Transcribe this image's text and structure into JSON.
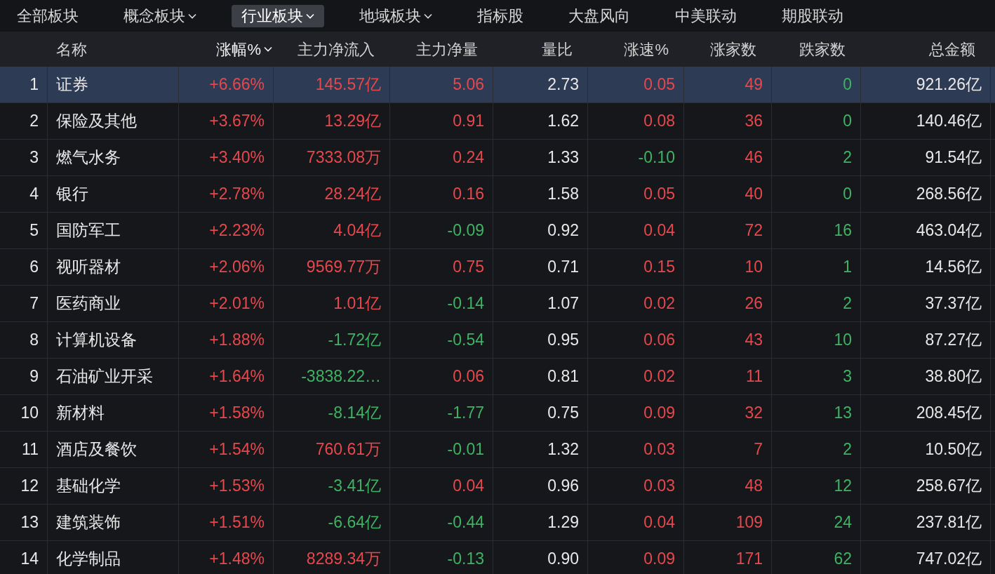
{
  "tabs": [
    {
      "label": "全部板块",
      "selected": false,
      "dropdown": false
    },
    {
      "label": "概念板块",
      "selected": false,
      "dropdown": true
    },
    {
      "label": "行业板块",
      "selected": true,
      "dropdown": true
    },
    {
      "label": "地域板块",
      "selected": false,
      "dropdown": true
    },
    {
      "label": "指标股",
      "selected": false,
      "dropdown": false
    },
    {
      "label": "大盘风向",
      "selected": false,
      "dropdown": false
    },
    {
      "label": "中美联动",
      "selected": false,
      "dropdown": false
    },
    {
      "label": "期股联动",
      "selected": false,
      "dropdown": false
    }
  ],
  "table": {
    "columns": [
      {
        "sorted": false
      },
      {
        "label": "名称",
        "sorted": false
      },
      {
        "label": "涨幅%",
        "sorted": true
      },
      {
        "label": "主力净流入",
        "sorted": false
      },
      {
        "label": "主力净量",
        "sorted": false
      },
      {
        "label": "量比",
        "sorted": false
      },
      {
        "label": "涨速%",
        "sorted": false
      },
      {
        "label": "涨家数",
        "sorted": false
      },
      {
        "label": "跌家数",
        "sorted": false
      },
      {
        "label": "总金额",
        "sorted": false
      }
    ],
    "rows": [
      {
        "selected": true,
        "cells": [
          {
            "text": "1",
            "color": "#e8e8e8"
          },
          {
            "text": "证券",
            "color": "#e8e8e8"
          },
          {
            "text": "+6.66%",
            "color": "#e5484d"
          },
          {
            "text": "145.57亿",
            "color": "#e5484d"
          },
          {
            "text": "5.06",
            "color": "#e5484d"
          },
          {
            "text": "2.73",
            "color": "#e8e8e8"
          },
          {
            "text": "0.05",
            "color": "#e5484d"
          },
          {
            "text": "49",
            "color": "#e5484d"
          },
          {
            "text": "0",
            "color": "#3fb264"
          },
          {
            "text": "921.26亿",
            "color": "#e8e8e8"
          }
        ]
      },
      {
        "selected": false,
        "cells": [
          {
            "text": "2",
            "color": "#e8e8e8"
          },
          {
            "text": "保险及其他",
            "color": "#e8e8e8"
          },
          {
            "text": "+3.67%",
            "color": "#e5484d"
          },
          {
            "text": "13.29亿",
            "color": "#e5484d"
          },
          {
            "text": "0.91",
            "color": "#e5484d"
          },
          {
            "text": "1.62",
            "color": "#e8e8e8"
          },
          {
            "text": "0.08",
            "color": "#e5484d"
          },
          {
            "text": "36",
            "color": "#e5484d"
          },
          {
            "text": "0",
            "color": "#3fb264"
          },
          {
            "text": "140.46亿",
            "color": "#e8e8e8"
          }
        ]
      },
      {
        "selected": false,
        "cells": [
          {
            "text": "3",
            "color": "#e8e8e8"
          },
          {
            "text": "燃气水务",
            "color": "#e8e8e8"
          },
          {
            "text": "+3.40%",
            "color": "#e5484d"
          },
          {
            "text": "7333.08万",
            "color": "#e5484d"
          },
          {
            "text": "0.24",
            "color": "#e5484d"
          },
          {
            "text": "1.33",
            "color": "#e8e8e8"
          },
          {
            "text": "-0.10",
            "color": "#3fb264"
          },
          {
            "text": "46",
            "color": "#e5484d"
          },
          {
            "text": "2",
            "color": "#3fb264"
          },
          {
            "text": "91.54亿",
            "color": "#e8e8e8"
          }
        ]
      },
      {
        "selected": false,
        "cells": [
          {
            "text": "4",
            "color": "#e8e8e8"
          },
          {
            "text": "银行",
            "color": "#e8e8e8"
          },
          {
            "text": "+2.78%",
            "color": "#e5484d"
          },
          {
            "text": "28.24亿",
            "color": "#e5484d"
          },
          {
            "text": "0.16",
            "color": "#e5484d"
          },
          {
            "text": "1.58",
            "color": "#e8e8e8"
          },
          {
            "text": "0.05",
            "color": "#e5484d"
          },
          {
            "text": "40",
            "color": "#e5484d"
          },
          {
            "text": "0",
            "color": "#3fb264"
          },
          {
            "text": "268.56亿",
            "color": "#e8e8e8"
          }
        ]
      },
      {
        "selected": false,
        "cells": [
          {
            "text": "5",
            "color": "#e8e8e8"
          },
          {
            "text": "国防军工",
            "color": "#e8e8e8"
          },
          {
            "text": "+2.23%",
            "color": "#e5484d"
          },
          {
            "text": "4.04亿",
            "color": "#e5484d"
          },
          {
            "text": "-0.09",
            "color": "#3fb264"
          },
          {
            "text": "0.92",
            "color": "#e8e8e8"
          },
          {
            "text": "0.04",
            "color": "#e5484d"
          },
          {
            "text": "72",
            "color": "#e5484d"
          },
          {
            "text": "16",
            "color": "#3fb264"
          },
          {
            "text": "463.04亿",
            "color": "#e8e8e8"
          }
        ]
      },
      {
        "selected": false,
        "cells": [
          {
            "text": "6",
            "color": "#e8e8e8"
          },
          {
            "text": "视听器材",
            "color": "#e8e8e8"
          },
          {
            "text": "+2.06%",
            "color": "#e5484d"
          },
          {
            "text": "9569.77万",
            "color": "#e5484d"
          },
          {
            "text": "0.75",
            "color": "#e5484d"
          },
          {
            "text": "0.71",
            "color": "#e8e8e8"
          },
          {
            "text": "0.15",
            "color": "#e5484d"
          },
          {
            "text": "10",
            "color": "#e5484d"
          },
          {
            "text": "1",
            "color": "#3fb264"
          },
          {
            "text": "14.56亿",
            "color": "#e8e8e8"
          }
        ]
      },
      {
        "selected": false,
        "cells": [
          {
            "text": "7",
            "color": "#e8e8e8"
          },
          {
            "text": "医药商业",
            "color": "#e8e8e8"
          },
          {
            "text": "+2.01%",
            "color": "#e5484d"
          },
          {
            "text": "1.01亿",
            "color": "#e5484d"
          },
          {
            "text": "-0.14",
            "color": "#3fb264"
          },
          {
            "text": "1.07",
            "color": "#e8e8e8"
          },
          {
            "text": "0.02",
            "color": "#e5484d"
          },
          {
            "text": "26",
            "color": "#e5484d"
          },
          {
            "text": "2",
            "color": "#3fb264"
          },
          {
            "text": "37.37亿",
            "color": "#e8e8e8"
          }
        ]
      },
      {
        "selected": false,
        "cells": [
          {
            "text": "8",
            "color": "#e8e8e8"
          },
          {
            "text": "计算机设备",
            "color": "#e8e8e8"
          },
          {
            "text": "+1.88%",
            "color": "#e5484d"
          },
          {
            "text": "-1.72亿",
            "color": "#3fb264"
          },
          {
            "text": "-0.54",
            "color": "#3fb264"
          },
          {
            "text": "0.95",
            "color": "#e8e8e8"
          },
          {
            "text": "0.06",
            "color": "#e5484d"
          },
          {
            "text": "43",
            "color": "#e5484d"
          },
          {
            "text": "10",
            "color": "#3fb264"
          },
          {
            "text": "87.27亿",
            "color": "#e8e8e8"
          }
        ]
      },
      {
        "selected": false,
        "cells": [
          {
            "text": "9",
            "color": "#e8e8e8"
          },
          {
            "text": "石油矿业开采",
            "color": "#e8e8e8"
          },
          {
            "text": "+1.64%",
            "color": "#e5484d"
          },
          {
            "text": "-3838.22…",
            "color": "#3fb264"
          },
          {
            "text": "0.06",
            "color": "#e5484d"
          },
          {
            "text": "0.81",
            "color": "#e8e8e8"
          },
          {
            "text": "0.02",
            "color": "#e5484d"
          },
          {
            "text": "11",
            "color": "#e5484d"
          },
          {
            "text": "3",
            "color": "#3fb264"
          },
          {
            "text": "38.80亿",
            "color": "#e8e8e8"
          }
        ]
      },
      {
        "selected": false,
        "cells": [
          {
            "text": "10",
            "color": "#e8e8e8"
          },
          {
            "text": "新材料",
            "color": "#e8e8e8"
          },
          {
            "text": "+1.58%",
            "color": "#e5484d"
          },
          {
            "text": "-8.14亿",
            "color": "#3fb264"
          },
          {
            "text": "-1.77",
            "color": "#3fb264"
          },
          {
            "text": "0.75",
            "color": "#e8e8e8"
          },
          {
            "text": "0.09",
            "color": "#e5484d"
          },
          {
            "text": "32",
            "color": "#e5484d"
          },
          {
            "text": "13",
            "color": "#3fb264"
          },
          {
            "text": "208.45亿",
            "color": "#e8e8e8"
          }
        ]
      },
      {
        "selected": false,
        "cells": [
          {
            "text": "11",
            "color": "#e8e8e8"
          },
          {
            "text": "酒店及餐饮",
            "color": "#e8e8e8"
          },
          {
            "text": "+1.54%",
            "color": "#e5484d"
          },
          {
            "text": "760.61万",
            "color": "#e5484d"
          },
          {
            "text": "-0.01",
            "color": "#3fb264"
          },
          {
            "text": "1.32",
            "color": "#e8e8e8"
          },
          {
            "text": "0.03",
            "color": "#e5484d"
          },
          {
            "text": "7",
            "color": "#e5484d"
          },
          {
            "text": "2",
            "color": "#3fb264"
          },
          {
            "text": "10.50亿",
            "color": "#e8e8e8"
          }
        ]
      },
      {
        "selected": false,
        "cells": [
          {
            "text": "12",
            "color": "#e8e8e8"
          },
          {
            "text": "基础化学",
            "color": "#e8e8e8"
          },
          {
            "text": "+1.53%",
            "color": "#e5484d"
          },
          {
            "text": "-3.41亿",
            "color": "#3fb264"
          },
          {
            "text": "0.04",
            "color": "#e5484d"
          },
          {
            "text": "0.96",
            "color": "#e8e8e8"
          },
          {
            "text": "0.03",
            "color": "#e5484d"
          },
          {
            "text": "48",
            "color": "#e5484d"
          },
          {
            "text": "12",
            "color": "#3fb264"
          },
          {
            "text": "258.67亿",
            "color": "#e8e8e8"
          }
        ]
      },
      {
        "selected": false,
        "cells": [
          {
            "text": "13",
            "color": "#e8e8e8"
          },
          {
            "text": "建筑装饰",
            "color": "#e8e8e8"
          },
          {
            "text": "+1.51%",
            "color": "#e5484d"
          },
          {
            "text": "-6.64亿",
            "color": "#3fb264"
          },
          {
            "text": "-0.44",
            "color": "#3fb264"
          },
          {
            "text": "1.29",
            "color": "#e8e8e8"
          },
          {
            "text": "0.04",
            "color": "#e5484d"
          },
          {
            "text": "109",
            "color": "#e5484d"
          },
          {
            "text": "24",
            "color": "#3fb264"
          },
          {
            "text": "237.81亿",
            "color": "#e8e8e8"
          }
        ]
      },
      {
        "selected": false,
        "cells": [
          {
            "text": "14",
            "color": "#e8e8e8"
          },
          {
            "text": "化学制品",
            "color": "#e8e8e8"
          },
          {
            "text": "+1.48%",
            "color": "#e5484d"
          },
          {
            "text": "8289.34万",
            "color": "#e5484d"
          },
          {
            "text": "-0.13",
            "color": "#3fb264"
          },
          {
            "text": "0.90",
            "color": "#e8e8e8"
          },
          {
            "text": "0.09",
            "color": "#e5484d"
          },
          {
            "text": "171",
            "color": "#e5484d"
          },
          {
            "text": "62",
            "color": "#3fb264"
          },
          {
            "text": "747.02亿",
            "color": "#e8e8e8"
          }
        ]
      }
    ]
  }
}
